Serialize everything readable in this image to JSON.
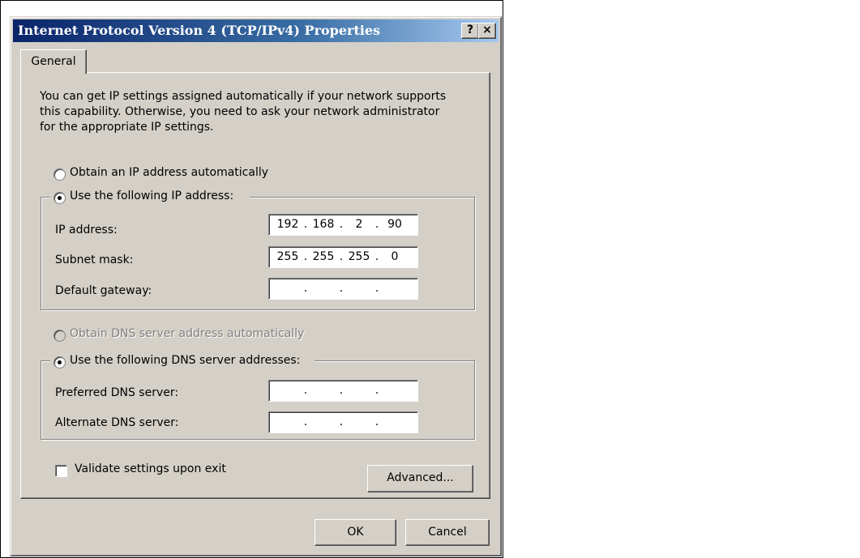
{
  "window": {
    "title": "Internet Protocol Version 4 (TCP/IPv4) Properties",
    "help_label": "?",
    "close_label": "×"
  },
  "tabs": [
    {
      "label": "General"
    }
  ],
  "description": {
    "line1": "You can get IP settings assigned automatically if your network supports",
    "line2": "this capability. Otherwise, you need to ask your network administrator",
    "line3": "for the appropriate IP settings."
  },
  "ip": {
    "auto_label": "Obtain an IP address automatically",
    "manual_label": "Use the following IP address:",
    "selected": "manual",
    "fields": [
      {
        "label": "IP address:",
        "octets": [
          "192",
          "168",
          "2",
          "90"
        ]
      },
      {
        "label": "Subnet mask:",
        "octets": [
          "255",
          "255",
          "255",
          "0"
        ]
      },
      {
        "label": "Default gateway:",
        "octets": [
          "",
          "",
          "",
          ""
        ]
      }
    ]
  },
  "dns": {
    "auto_label": "Obtain DNS server address automatically",
    "auto_disabled": true,
    "manual_label": "Use the following DNS server addresses:",
    "selected": "manual",
    "fields": [
      {
        "label": "Preferred DNS server:",
        "octets": [
          "",
          "",
          "",
          ""
        ]
      },
      {
        "label": "Alternate DNS server:",
        "octets": [
          "",
          "",
          "",
          ""
        ]
      }
    ]
  },
  "validate": {
    "label": "Validate settings upon exit",
    "checked": false
  },
  "buttons": {
    "advanced": "Advanced...",
    "ok": "OK",
    "cancel": "Cancel"
  }
}
